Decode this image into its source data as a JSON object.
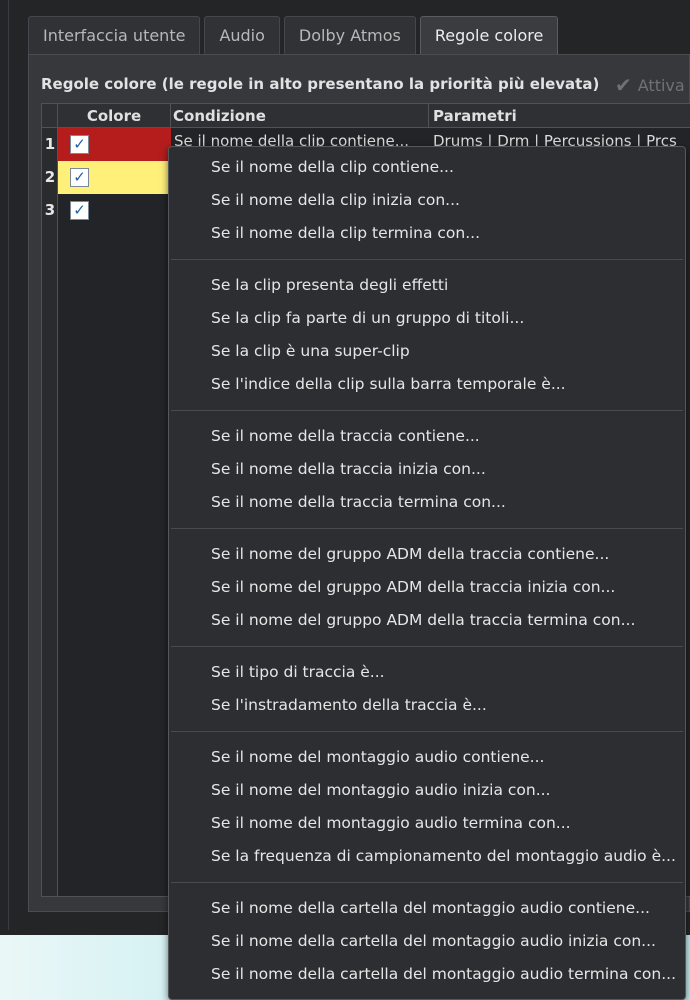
{
  "tabs": [
    {
      "label": "Interfaccia utente",
      "active": false
    },
    {
      "label": "Audio",
      "active": false
    },
    {
      "label": "Dolby Atmos",
      "active": false
    },
    {
      "label": "Regole colore",
      "active": true
    }
  ],
  "panel": {
    "title": "Regole colore (le regole in alto presentano la priorità più elevata)",
    "attiva_label": "Attiva",
    "attiva_icon": "checkmark-icon"
  },
  "table": {
    "headers": {
      "colore": "Colore",
      "condizione": "Condizione",
      "parametri": "Parametri"
    },
    "rows": [
      {
        "num": "1",
        "color": "#b51d1d",
        "checked": true,
        "condition": "Se il nome della clip contiene...",
        "params": "Drums | Drm | Percussions | Prcs"
      },
      {
        "num": "2",
        "color": "#fff07a",
        "checked": true,
        "condition": "",
        "params": ""
      },
      {
        "num": "3",
        "color": "#232427",
        "checked": true,
        "condition": "",
        "params": ""
      }
    ]
  },
  "menu": {
    "groups": [
      [
        "Se il nome della clip contiene...",
        "Se il nome della clip inizia con...",
        "Se il nome della clip termina con..."
      ],
      [
        "Se la clip presenta degli effetti",
        "Se la clip fa parte di un gruppo di titoli...",
        "Se la clip è una super-clip",
        "Se l'indice della clip sulla barra temporale è..."
      ],
      [
        "Se il nome della traccia contiene...",
        "Se il nome della traccia inizia con...",
        "Se il nome della traccia termina con..."
      ],
      [
        "Se il nome del gruppo ADM della traccia contiene...",
        "Se il nome del gruppo ADM della traccia inizia con...",
        "Se il nome del gruppo ADM della traccia termina con..."
      ],
      [
        "Se il tipo di traccia è...",
        "Se l'instradamento della traccia è..."
      ],
      [
        "Se il nome del montaggio audio contiene...",
        "Se il nome del montaggio audio inizia con...",
        "Se il nome del montaggio audio termina con...",
        "Se la frequenza di campionamento del montaggio audio è..."
      ],
      [
        "Se il nome della cartella del montaggio audio contiene...",
        "Se il nome della cartella del montaggio audio inizia con...",
        "Se il nome della cartella del montaggio audio termina con..."
      ]
    ]
  }
}
